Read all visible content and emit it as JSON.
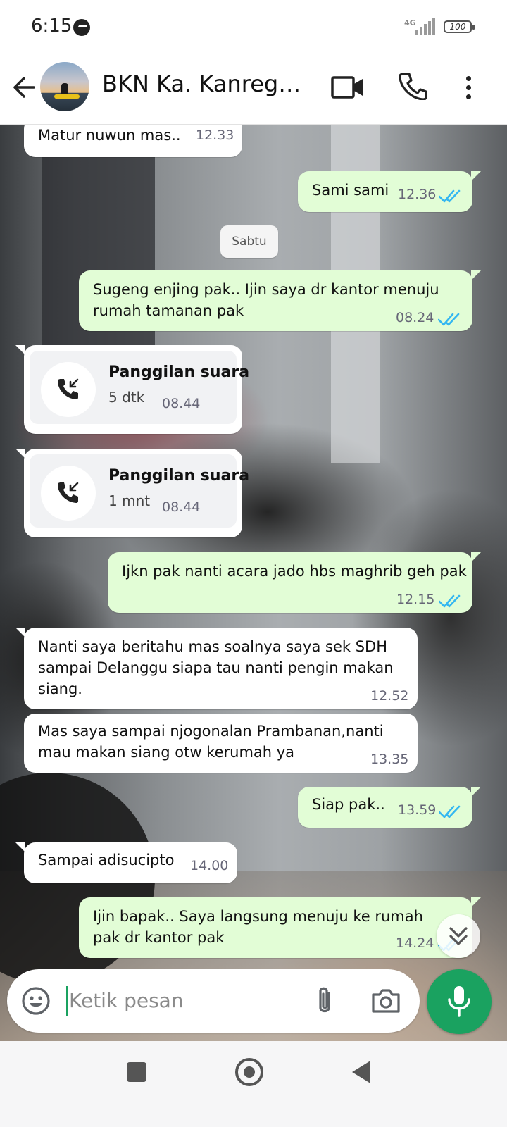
{
  "status_bar": {
    "time": "6:15",
    "network": "4G",
    "battery": "100"
  },
  "header": {
    "contact_name": "BKN Ka. Kanreg I..."
  },
  "messages": [
    {
      "text": "Matur nuwun mas..",
      "time": "12.33"
    },
    {
      "text": "Sami sami",
      "time": "12.36"
    },
    {
      "text": "Sugeng enjing pak.. Ijin saya dr kantor menuju rumah tamanan pak",
      "time": "08.24"
    },
    {
      "title": "Panggilan suara",
      "duration": "5 dtk",
      "time": "08.44"
    },
    {
      "title": "Panggilan suara",
      "duration": "1 mnt",
      "time": "08.44"
    },
    {
      "text": "Ijkn pak nanti acara jado hbs maghrib geh pak",
      "time": "12.15"
    },
    {
      "text": "Nanti saya beritahu mas soalnya saya sek SDH sampai Delanggu siapa tau nanti pengin makan siang.",
      "time": "12.52"
    },
    {
      "text": "Mas saya sampai njogonalan Prambanan,nanti mau makan siang otw kerumah ya",
      "time": "13.35"
    },
    {
      "text": "Siap pak..",
      "time": "13.59"
    },
    {
      "text": "Sampai adisucipto",
      "time": "14.00"
    },
    {
      "text": "Ijin bapak.. Saya langsung menuju ke rumah pak dr kantor pak",
      "time": "14.24"
    }
  ],
  "day_label": "Sabtu",
  "composer": {
    "placeholder": "Ketik pesan"
  },
  "colors": {
    "accent": "#1aa260",
    "outgoing_bubble": "#e2fdd6",
    "incoming_bubble": "#ffffff",
    "read_ticks": "#34b7f1"
  },
  "icons": {
    "header": [
      "back-arrow-icon",
      "video-call-icon",
      "phone-icon",
      "more-vert-icon"
    ],
    "composer": [
      "emoji-icon",
      "attach-icon",
      "camera-icon",
      "mic-icon"
    ],
    "navigation": [
      "recents-icon",
      "home-icon",
      "back-icon"
    ]
  }
}
